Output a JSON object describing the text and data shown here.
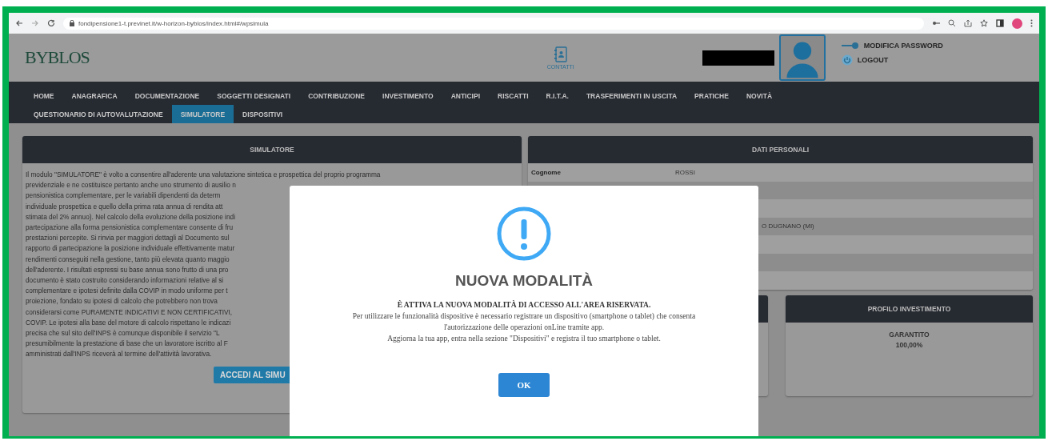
{
  "browser": {
    "url": "fondipensione1-t.previnet.it/w-horizon-byblos/index.html#/wpsimula"
  },
  "header": {
    "logo": "BYBLOS",
    "contacts": "CONTATTI",
    "links": [
      {
        "kind": "password",
        "label": "MODIFICA PASSWORD"
      },
      {
        "kind": "logout",
        "label": "LOGOUT"
      }
    ]
  },
  "nav": {
    "rows": [
      {
        "items": [
          {
            "label": "HOME",
            "selected": false
          },
          {
            "label": "ANAGRAFICA",
            "selected": false
          },
          {
            "label": "DOCUMENTAZIONE",
            "selected": false
          },
          {
            "label": "SOGGETTI DESIGNATI",
            "selected": false
          },
          {
            "label": "CONTRIBUZIONE",
            "selected": false
          },
          {
            "label": "INVESTIMENTO",
            "selected": false
          },
          {
            "label": "ANTICIPI",
            "selected": false
          },
          {
            "label": "RISCATTI",
            "selected": false
          },
          {
            "label": "R.I.T.A.",
            "selected": false
          },
          {
            "label": "TRASFERIMENTI IN USCITA",
            "selected": false
          },
          {
            "label": "PRATICHE",
            "selected": false
          },
          {
            "label": "NOVITÀ",
            "selected": false
          }
        ]
      },
      {
        "items": [
          {
            "label": "QUESTIONARIO DI AUTOVALUTAZIONE",
            "selected": false
          },
          {
            "label": "SIMULATORE",
            "selected": true
          },
          {
            "label": "DISPOSITIVI",
            "selected": false
          }
        ]
      }
    ]
  },
  "simulator_panel": {
    "title": "SIMULATORE",
    "lines": [
      "Il modulo \"SIMULATORE\" è volto a consentire all'aderente una valutazione sintetica e prospettica del proprio programma",
      "previdenziale e ne costituisce pertanto anche uno strumento di ausilio n",
      "pensionistica complementare, per le variabili dipendenti da determ",
      "individuale prospettica e quello della prima rata annua di rendita att",
      "stimata del 2% annuo). Nel calcolo della evoluzione della posizione indi",
      "partecipazione alla forma pensionistica complementare consente di fru",
      "prestazioni percepite. Si rinvia per maggiori dettagli al Documento sul",
      "rapporto di partecipazione la posizione individuale effettivamente matur",
      "rendimenti conseguiti nella gestione, tanto più elevata quanto maggio",
      "dell'aderente. I risultati espressi su base annua sono frutto di una pro",
      "documento è stato costruito considerando informazioni relative al si",
      "complementare e ipotesi definite dalla COVIP in modo uniforme per t",
      "proiezione, fondato su ipotesi di calcolo che potrebbero non trova",
      "considerarsi come PURAMENTE INDICATIVI E NON CERTIFICATIVI,",
      "COVIP. Le ipotesi alla base del motore di calcolo rispettano le indicazi",
      "precisa che sul sito dell'INPS è comunque disponibile il servizio \"L",
      "presumibilmente la prestazione di base che un lavoratore iscritto al F",
      "amministrati dall'INPS riceverà al termine dell'attività lavorativa."
    ],
    "button": "ACCEDI AL SIMU"
  },
  "personal_panel": {
    "title": "DATI PERSONALI",
    "rows": [
      {
        "kind": "full",
        "label": "Cognome",
        "value": "ROSSI"
      },
      {
        "kind": "covered"
      },
      {
        "kind": "covered"
      },
      {
        "kind": "covered",
        "value": "O DUGNANO (MI)"
      },
      {
        "kind": "covered"
      },
      {
        "kind": "covered"
      },
      {
        "kind": "covered"
      }
    ]
  },
  "investment_panel": {
    "title": "PROFILO INVESTIMENTO",
    "profile": "GARANTITO",
    "share": "100,00%"
  },
  "modal": {
    "title": "NUOVA MODALITÀ",
    "headline": "È ATTIVA LA NUOVA MODALITÀ DI ACCESSO ALL'AREA RISERVATA.",
    "lines": [
      "Per utilizzare le funzionalità dispositive è necessario registrare un dispositivo (smartphone o tablet) che consenta",
      "l'autorizzazione delle operazioni onLine tramite app.",
      "Aggiorna la tua app, entra nella sezione \"Dispositivi\" e registra il tuo smartphone o tablet."
    ],
    "button": "OK"
  }
}
